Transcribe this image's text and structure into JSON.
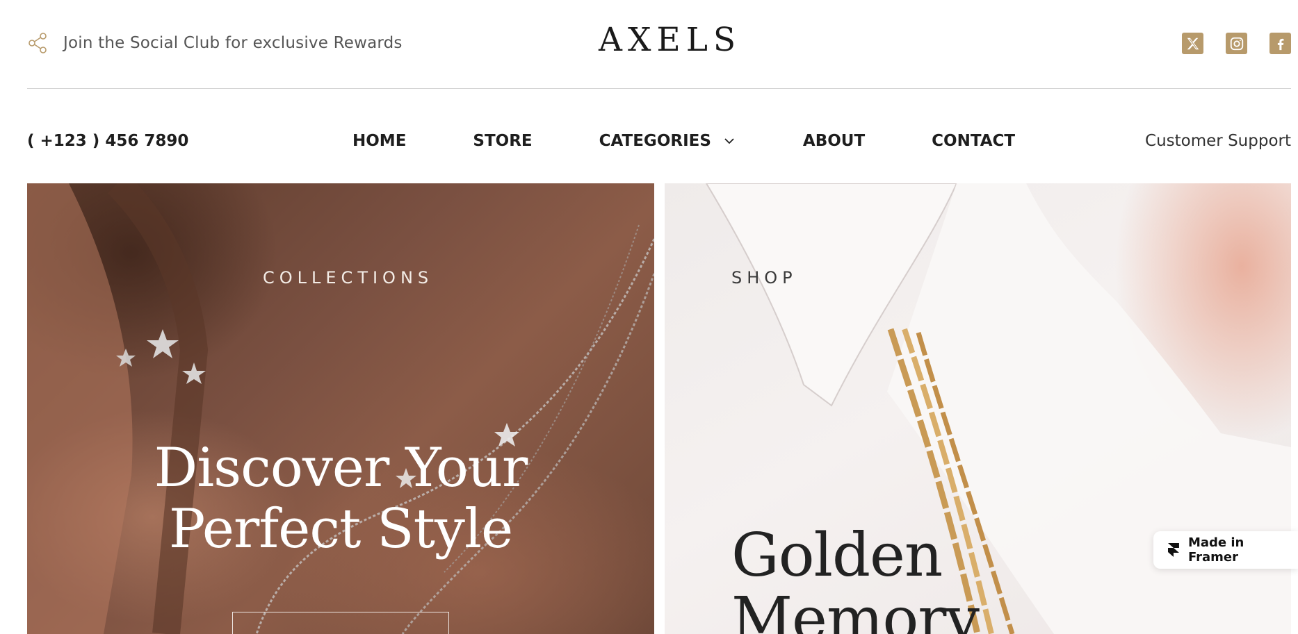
{
  "topbar": {
    "promo_text": "Join the Social Club for exclusive Rewards",
    "share_icon": "share-icon",
    "logo": "AXELS",
    "socials": [
      {
        "name": "x-icon"
      },
      {
        "name": "instagram-icon"
      },
      {
        "name": "facebook-icon"
      }
    ],
    "accent_color": "#b79a6b"
  },
  "nav": {
    "phone": "( +123 ) 456 7890",
    "items": [
      {
        "label": "HOME"
      },
      {
        "label": "STORE"
      },
      {
        "label": "CATEGORIES",
        "has_dropdown": true
      },
      {
        "label": "ABOUT"
      },
      {
        "label": "CONTACT"
      }
    ],
    "support": "Customer Support"
  },
  "hero": {
    "left": {
      "eyebrow": "COLLECTIONS",
      "title_line1": "Discover Your",
      "title_line2": "Perfect Style"
    },
    "right": {
      "eyebrow": "SHOP",
      "title_line1": "Golden",
      "title_line2": "Memory"
    }
  },
  "badge": {
    "label": "Made in Framer"
  }
}
